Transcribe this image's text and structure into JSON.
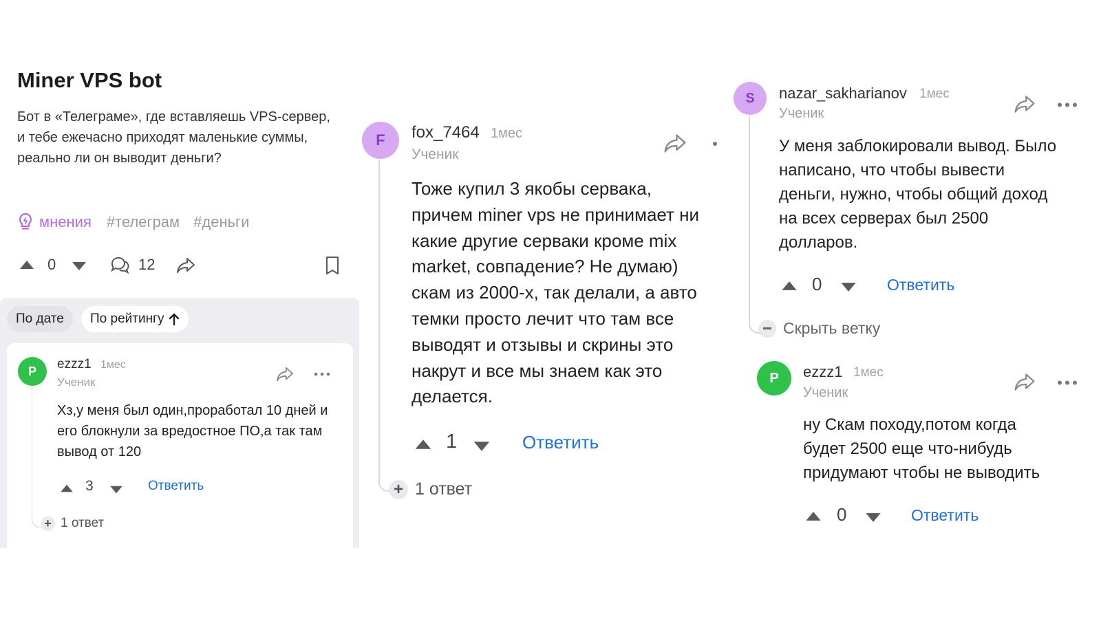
{
  "question": {
    "title": "Miner VPS bot",
    "text": "Бот в «Телеграме», где вставляешь VPS-сервер, и тебе ежечасно приходят маленькие суммы, реально ли он выводит деньги?",
    "tags": [
      "мнения",
      "#телеграм",
      "#деньги"
    ],
    "score": "0",
    "comments_count": "12"
  },
  "sort": {
    "by_date": "По дате",
    "by_rating": "По рейтингу"
  },
  "comment_ezzz1": {
    "avatar_letter": "P",
    "username": "ezzz1",
    "date": "1мес",
    "role": "Ученик",
    "text": "Хз,у меня был один,проработал 10 дней и его блокнули за вредостное ПО,а так там вывод от 120",
    "score": "3",
    "reply_label": "Ответить",
    "replies_label": "1 ответ"
  },
  "comment_fox": {
    "avatar_letter": "F",
    "username": "fox_7464",
    "date": "1мес",
    "role": "Ученик",
    "lines": [
      "Тоже купил 3 якобы сервака,",
      "причем miner vps не принимает ни",
      "какие другие серваки кроме mix",
      "market, совпадение? Не думаю)",
      "скам из 2000-х, так делали, а авто",
      "темки просто лечит что там все",
      "выводят и отзывы и скрины это",
      "накрут и все мы знаем как это",
      "делается."
    ],
    "score": "1",
    "reply_label": "Ответить",
    "replies_label": "1 ответ"
  },
  "comment_nazar": {
    "avatar_letter": "S",
    "username": "nazar_sakharianov",
    "date": "1мес",
    "role": "Ученик",
    "lines": [
      "У меня заблокировали вывод. Было",
      "написано, что чтобы вывести",
      "деньги, нужно, чтобы общий доход",
      "на всех серверах был 2500",
      "долларов."
    ],
    "score": "0",
    "reply_label": "Ответить",
    "hide_branch_label": "Скрыть ветку"
  },
  "comment_ezzz1_reply": {
    "avatar_letter": "P",
    "username": "ezzz1",
    "date": "1мес",
    "role": "Ученик",
    "lines": [
      "ну Скам походу,потом когда",
      "будет 2500 еще что-нибудь",
      "придумают чтобы не выводить"
    ],
    "score": "0",
    "reply_label": "Ответить"
  },
  "colors": {
    "accent_blue": "#1f6fe0",
    "opinion_purple": "#b46be6",
    "avatar_green": "#2ec24a",
    "avatar_purple": "#d6a9f2",
    "muted_text": "#a0a0a0",
    "sort_background": "#eeeef2"
  },
  "icons": [
    "lightbulb-icon",
    "arrow-up-icon",
    "arrow-down-icon",
    "comment-icon",
    "share-icon",
    "bookmark-icon",
    "more-icon",
    "plus-icon",
    "minus-icon",
    "sort-arrow-up-icon"
  ]
}
